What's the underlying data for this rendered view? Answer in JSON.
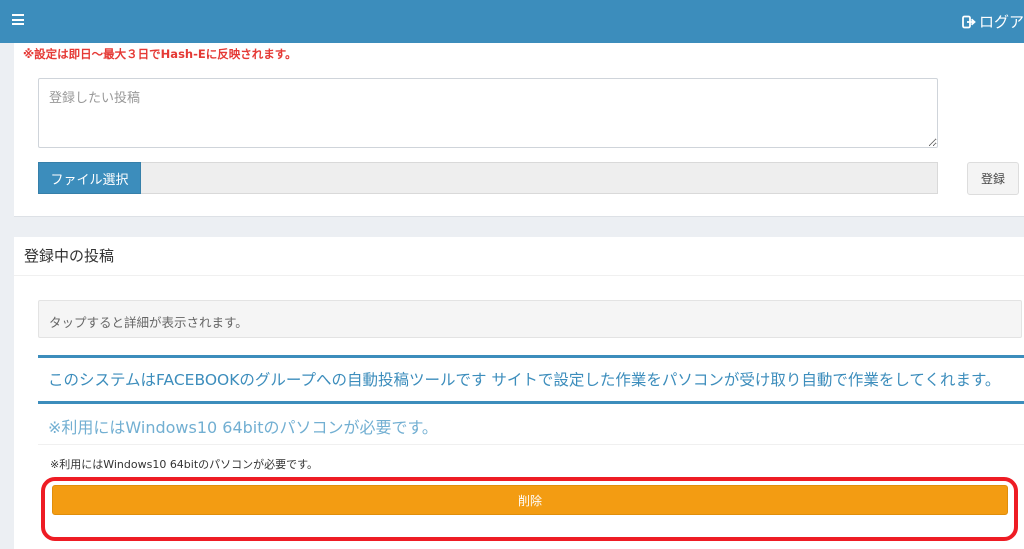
{
  "header": {
    "logout_label": "ログアウ",
    "colors": {
      "bar": "#3c8dbc"
    }
  },
  "register_panel": {
    "notice": "※設定は即日〜最大３日でHash-Eに反映されます。",
    "post_placeholder": "登録したい投稿",
    "file_button_label": "ファイル選択",
    "register_button_label": "登録"
  },
  "posts_panel": {
    "title": "登録中の投稿",
    "tap_hint": "タップすると詳細が表示されます。",
    "items": [
      {
        "title": "このシステムはFACEBOOKのグループへの自動投稿ツールです サイトで設定した作業をパソコンが受け取り自動で作業をしてくれます。"
      },
      {
        "title": "※利用にはWindows10 64bitのパソコンが必要です。",
        "body": "※利用にはWindows10 64bitのパソコンが必要です。",
        "delete_label": "削除"
      }
    ]
  },
  "colors": {
    "primary": "#3c8dbc",
    "warning": "#f39c12",
    "notice": "#e53935",
    "highlight": "#ee1c24"
  }
}
